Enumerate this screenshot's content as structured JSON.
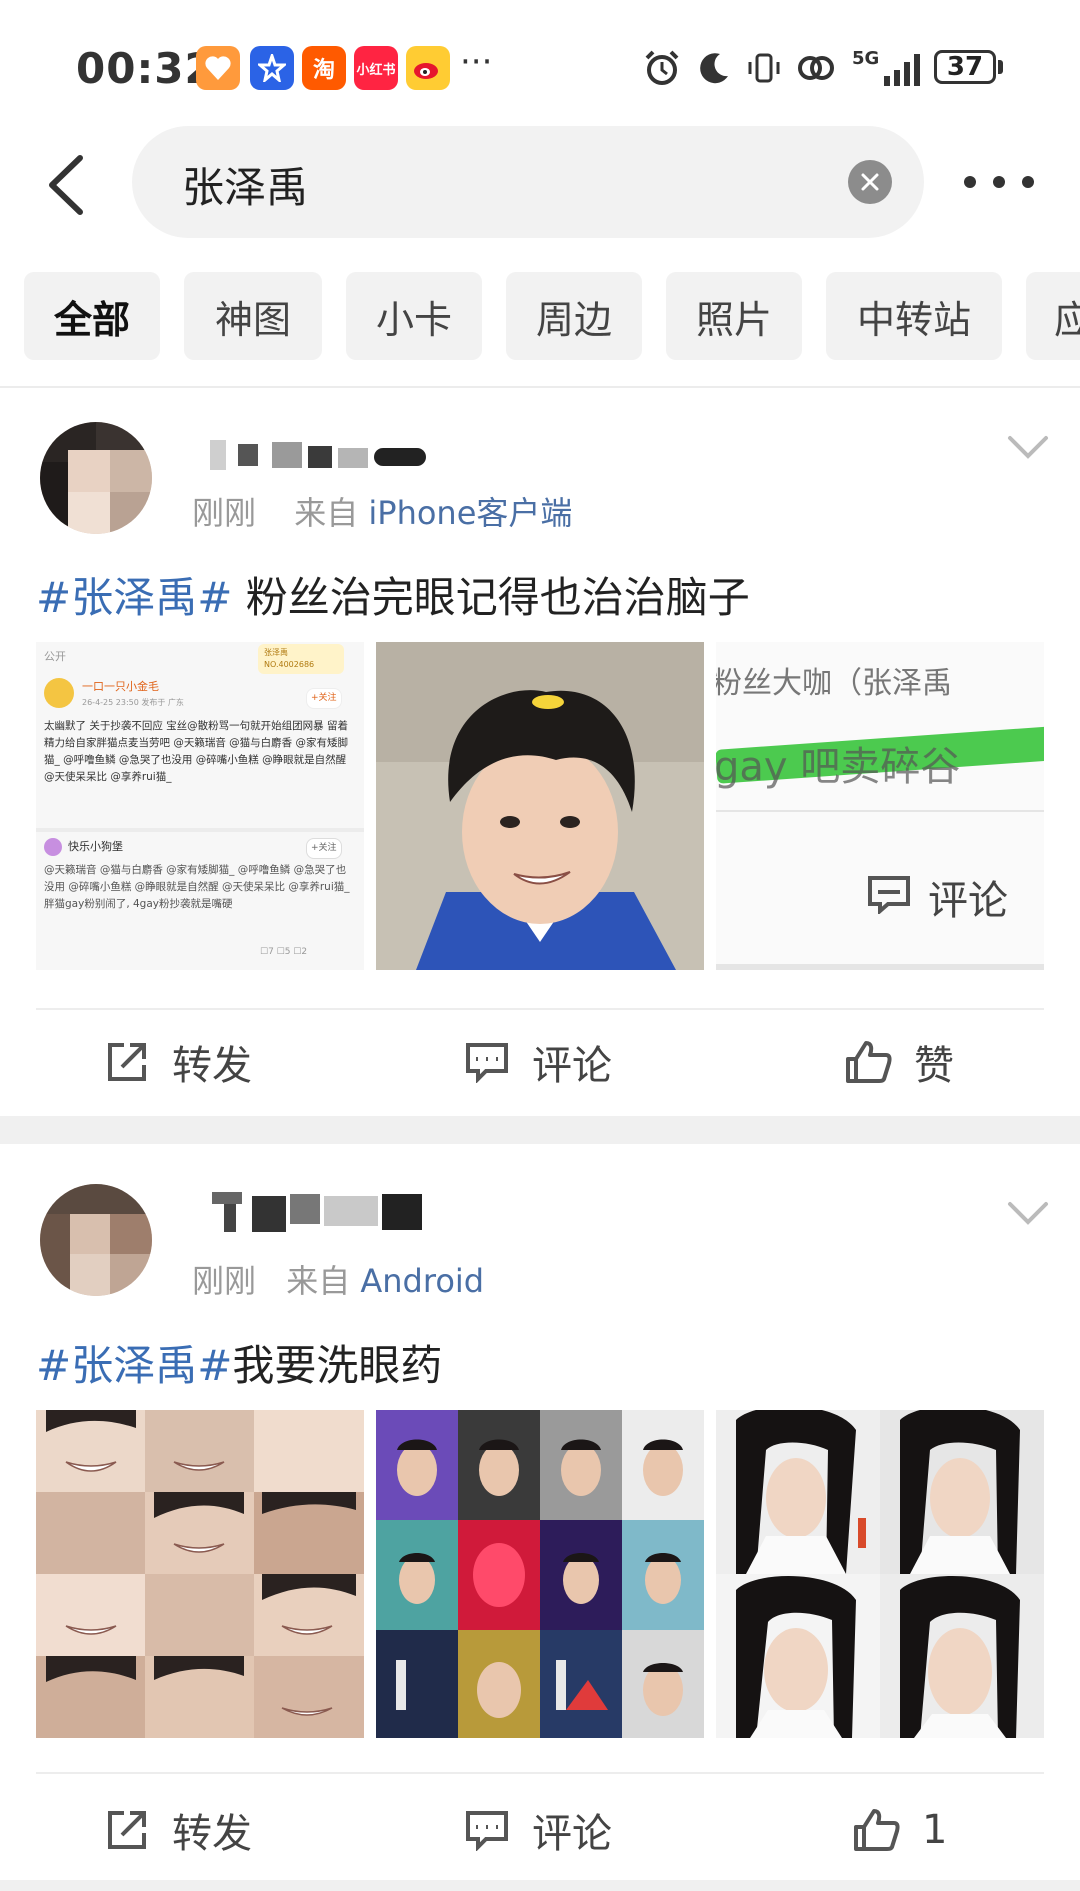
{
  "status_bar": {
    "time": "00:32",
    "app_icons": [
      "heart-app-icon",
      "star-app-icon",
      "taobao-icon",
      "xiaohongshu-icon",
      "weibo-icon"
    ],
    "taobao_label": "淘",
    "xiaohongshu_label": "小红书",
    "more": "···",
    "network": "5G",
    "battery": "37"
  },
  "search": {
    "query": "张泽禹"
  },
  "tabs": [
    {
      "label": "全部",
      "active": true
    },
    {
      "label": "神图"
    },
    {
      "label": "小卡"
    },
    {
      "label": "周边"
    },
    {
      "label": "照片"
    },
    {
      "label": "中转站"
    },
    {
      "label": "应"
    }
  ],
  "posts": [
    {
      "time": "刚刚",
      "from_prefix": "来自",
      "source": "iPhone客户端",
      "hashtag": "#张泽禹#",
      "text": " 粉丝治完眼记得也治治脑子",
      "screenshot": {
        "visibility": "公开",
        "badge_line1": "张泽禹",
        "badge_line2": "NO.4002686",
        "user1": "一口一只小金毛",
        "user1_meta": "26-4-25 23:50  发布于 广东",
        "follow": "+关注",
        "body1": "太幽默了 关于抄袭不回应 宝丝@散粉骂一句就开始组团网暴 留着精力给自家胖猫点麦当劳吧 @天籁瑞音 @猫与白麝香 @家有矮脚猫_ @呼噜鱼鳞 @急哭了也没用 @碎嘴小鱼糕 @睁眼就是自然醒 @天使呆呆比 @享养rui猫_",
        "user2": "快乐小狗堡",
        "body2": "@天籁瑞音 @猫与白麝香 @家有矮脚猫_ @呼噜鱼鳞 @急哭了也没用 @碎嘴小鱼糕 @睁眼就是自然醒 @天使呆呆比 @享养rui猫_ 胖猫gay粉别闹了, 4gay粉抄袭就是嘴硬",
        "counts": "☐7  ☐5  ☐2"
      },
      "crop": {
        "line1": "粉丝大咖（张泽禹",
        "line2": "gay 吧卖碎谷",
        "comment": "评论"
      },
      "actions": {
        "repost": "转发",
        "comment": "评论",
        "like": "赞"
      }
    },
    {
      "time": "刚刚",
      "from_prefix": "来自",
      "source": "Android",
      "hashtag": "#张泽禹#",
      "text": "我要洗眼药",
      "actions": {
        "repost": "转发",
        "comment": "评论",
        "like": "1"
      }
    }
  ]
}
